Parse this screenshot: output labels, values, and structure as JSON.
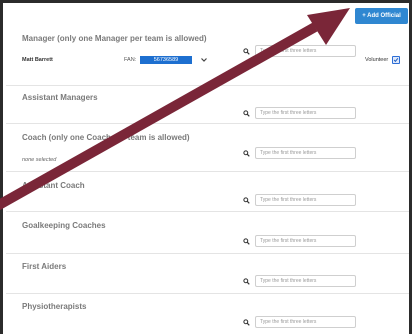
{
  "toolbar": {
    "add_official": "+ Add Official"
  },
  "search_placeholder": "Type the first three letters",
  "sections": {
    "manager": {
      "title": "Manager (only one Manager per team is allowed)",
      "person": "Matt Barrett",
      "fan_label": "FAN:",
      "fan_value": "56736589",
      "volunteer_label": "Volunteer"
    },
    "assistant_managers": {
      "title": "Assistant Managers"
    },
    "coach": {
      "title": "Coach (only one Coach per team is allowed)",
      "status": "none selected"
    },
    "assistant_coach": {
      "title": "Assistant Coach"
    },
    "goalkeeping": {
      "title": "Goalkeeping Coaches"
    },
    "first_aiders": {
      "title": "First Aiders"
    },
    "physio": {
      "title": "Physiotherapists"
    }
  },
  "colors": {
    "accent": "#2f87d1",
    "fan_field": "#1d6fd0",
    "annotation_arrow": "#7a2638"
  }
}
